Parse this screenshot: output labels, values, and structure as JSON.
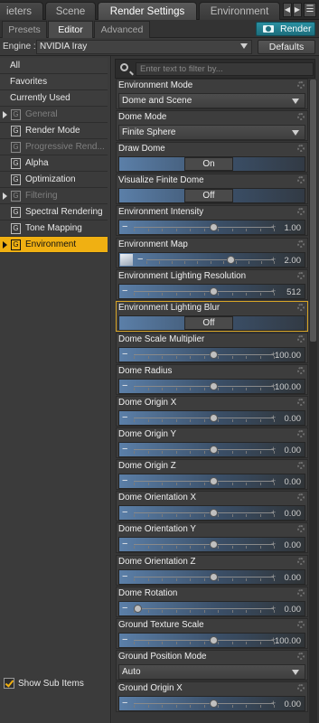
{
  "top_tabs": [
    "ieters",
    "Scene",
    "Render Settings",
    "Environment"
  ],
  "sub_tabs": [
    "Presets",
    "Editor",
    "Advanced"
  ],
  "render_button": "Render",
  "engine": {
    "label": "Engine :",
    "value": "NVIDIA Iray",
    "defaults": "Defaults"
  },
  "left_panel": {
    "items": [
      {
        "label": "All"
      },
      {
        "label": "Favorites"
      },
      {
        "label": "Currently Used"
      },
      {
        "label": "General",
        "icon": "G",
        "dim": true,
        "expand": true
      },
      {
        "label": "Render Mode",
        "icon": "G"
      },
      {
        "label": "Progressive Rend...",
        "icon": "G",
        "dim": true
      },
      {
        "label": "Alpha",
        "icon": "G"
      },
      {
        "label": "Optimization",
        "icon": "G"
      },
      {
        "label": "Filtering",
        "icon": "G",
        "dim": true,
        "expand": true
      },
      {
        "label": "Spectral Rendering",
        "icon": "G"
      },
      {
        "label": "Tone Mapping",
        "icon": "G"
      },
      {
        "label": "Environment",
        "icon": "G",
        "selected": true,
        "expand": true
      }
    ],
    "show_sub_items": "Show Sub Items"
  },
  "filter": {
    "placeholder": "Enter text to filter by..."
  },
  "properties": [
    {
      "label": "Environment Mode",
      "type": "select",
      "value": "Dome and Scene"
    },
    {
      "label": "Dome Mode",
      "type": "select",
      "value": "Finite Sphere"
    },
    {
      "label": "Draw Dome",
      "type": "toggle",
      "value": "On"
    },
    {
      "label": "Visualize Finite Dome",
      "type": "toggle",
      "value": "Off"
    },
    {
      "label": "Environment Intensity",
      "type": "slider",
      "value": "1.00",
      "fraction": 0.57
    },
    {
      "label": "Environment Map",
      "type": "slider",
      "value": "2.00",
      "fraction": 0.66,
      "map": true
    },
    {
      "label": "Environment Lighting Resolution",
      "type": "slider",
      "value": "512",
      "fraction": 0.57
    },
    {
      "label": "Environment Lighting Blur",
      "type": "toggle",
      "value": "Off",
      "highlight": true
    },
    {
      "label": "Dome Scale Multiplier",
      "type": "slider",
      "value": "100.00",
      "fraction": 0.57
    },
    {
      "label": "Dome Radius",
      "type": "slider",
      "value": "100.00",
      "fraction": 0.57
    },
    {
      "label": "Dome Origin X",
      "type": "slider",
      "value": "0.00",
      "fraction": 0.57
    },
    {
      "label": "Dome Origin Y",
      "type": "slider",
      "value": "0.00",
      "fraction": 0.57
    },
    {
      "label": "Dome Origin Z",
      "type": "slider",
      "value": "0.00",
      "fraction": 0.57
    },
    {
      "label": "Dome Orientation X",
      "type": "slider",
      "value": "0.00",
      "fraction": 0.57
    },
    {
      "label": "Dome Orientation Y",
      "type": "slider",
      "value": "0.00",
      "fraction": 0.57
    },
    {
      "label": "Dome Orientation Z",
      "type": "slider",
      "value": "0.00",
      "fraction": 0.57
    },
    {
      "label": "Dome Rotation",
      "type": "slider",
      "value": "0.00",
      "fraction": 0.0
    },
    {
      "label": "Ground Texture Scale",
      "type": "slider",
      "value": "100.00",
      "fraction": 0.57
    },
    {
      "label": "Ground Position Mode",
      "type": "select",
      "value": "Auto"
    },
    {
      "label": "Ground Origin X",
      "type": "slider",
      "value": "0.00",
      "fraction": 0.57
    }
  ],
  "colors": {
    "accent": "#f0b012",
    "render_button": "#2a8fa1",
    "slider_fill": "#5b7fa8"
  }
}
